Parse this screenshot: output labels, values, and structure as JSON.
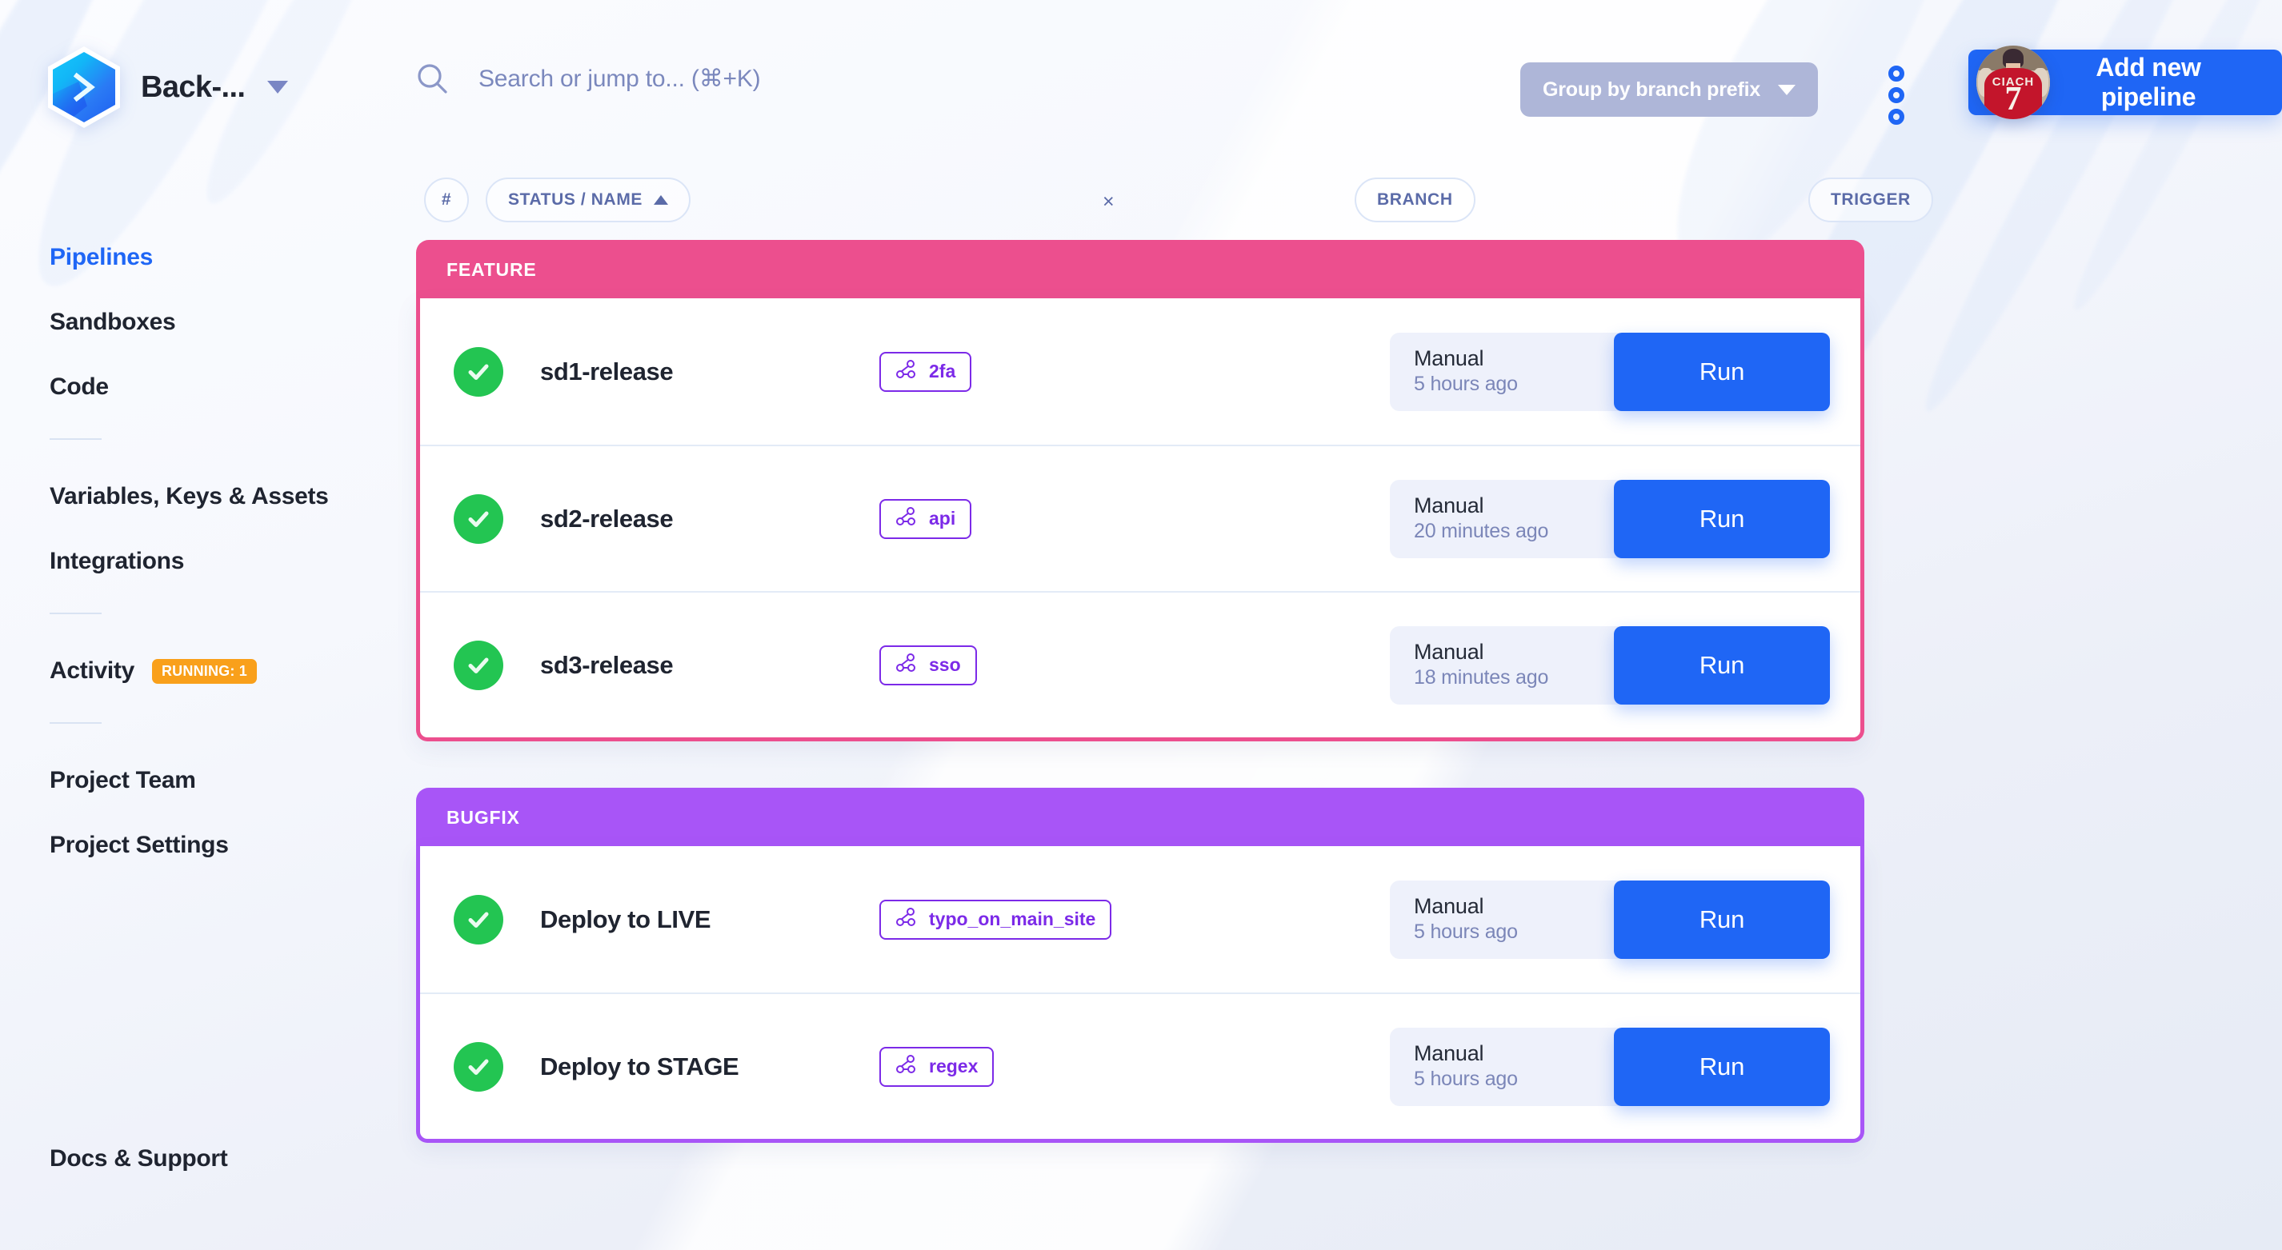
{
  "brand": {
    "title": "Back-...",
    "logo_icon": "buddy-hexagon-chevron-logo",
    "dropdown_icon": "caret-down-icon"
  },
  "search": {
    "placeholder": "Search or jump to... (⌘+K)",
    "value": "",
    "icon": "search-icon"
  },
  "toolbar": {
    "group_by_label": "Group by branch prefix",
    "group_by_caret_icon": "caret-down-icon",
    "kebab_icon": "more-options-vertical-icon",
    "add_pipeline_label": "Add new pipeline",
    "add_icon": "plus-circle-icon",
    "avatar_name": "CIACH",
    "avatar_number": "7",
    "accent_blue": "#1f66f5",
    "group_btn_bg": "#aeb6d8"
  },
  "sidebar": {
    "items": [
      {
        "label": "Pipelines",
        "active": true
      },
      {
        "label": "Sandboxes",
        "active": false
      },
      {
        "label": "Code",
        "active": false
      },
      {
        "label": "Variables, Keys & Assets",
        "active": false
      },
      {
        "label": "Integrations",
        "active": false
      },
      {
        "label": "Activity",
        "active": false,
        "badge": "RUNNING: 1",
        "badge_color": "#f9a01b"
      },
      {
        "label": "Project Team",
        "active": false
      },
      {
        "label": "Project Settings",
        "active": false
      },
      {
        "label": "Docs & Support",
        "active": false
      }
    ]
  },
  "filters": {
    "hash_label": "#",
    "status_label": "STATUS / NAME",
    "status_sort_icon": "caret-up-icon",
    "status_clear_icon": "close-icon",
    "status_clear_label": "×",
    "branch_label": "BRANCH",
    "trigger_label": "TRIGGER"
  },
  "groups": [
    {
      "name": "FEATURE",
      "color": "#ec4f8e",
      "rows": [
        {
          "status_icon": "check-circle-icon",
          "name": "sd1-release",
          "branch_icon": "git-branch-icon",
          "branch": "2fa",
          "trigger": "Manual",
          "time": "5 hours ago",
          "action_label": "Run"
        },
        {
          "status_icon": "check-circle-icon",
          "name": "sd2-release",
          "branch_icon": "git-branch-icon",
          "branch": "api",
          "trigger": "Manual",
          "time": "20 minutes ago",
          "action_label": "Run"
        },
        {
          "status_icon": "check-circle-icon",
          "name": "sd3-release",
          "branch_icon": "git-branch-icon",
          "branch": "sso",
          "trigger": "Manual",
          "time": "18 minutes ago",
          "action_label": "Run"
        }
      ]
    },
    {
      "name": "BUGFIX",
      "color": "#a855f7",
      "rows": [
        {
          "status_icon": "check-circle-icon",
          "name": "Deploy to LIVE",
          "branch_icon": "git-branch-icon",
          "branch": "typo_on_main_site",
          "trigger": "Manual",
          "time": "5 hours ago",
          "action_label": "Run"
        },
        {
          "status_icon": "check-circle-icon",
          "name": "Deploy to STAGE",
          "branch_icon": "git-branch-icon",
          "branch": "regex",
          "trigger": "Manual",
          "time": "5 hours ago",
          "action_label": "Run"
        }
      ]
    }
  ]
}
